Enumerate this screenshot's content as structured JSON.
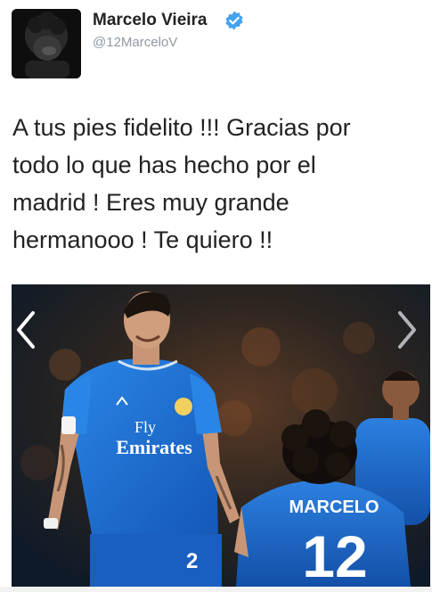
{
  "user": {
    "display_name": "Marcelo Vieira",
    "handle": "@12MarceloV",
    "verified": true
  },
  "tweet": {
    "lines": [
      "A tus pies fidelito !!! Gracias por",
      "todo lo que has hecho por el",
      "madrid ! Eres muy grande",
      "hermanooo ! Te quiero !!"
    ]
  },
  "media": {
    "shirt_sponsor_top": "Fly",
    "shirt_sponsor_bottom": "Emirates",
    "back_name": "MARCELO",
    "back_number": "12",
    "shorts_number": "2"
  },
  "colors": {
    "accent": "#1da1f2",
    "kit_blue": "#1d74d8",
    "verified": "#45a2ee"
  },
  "icons": {
    "verified": "verified-badge-icon",
    "prev": "chevron-left-icon",
    "next": "chevron-right-icon"
  }
}
